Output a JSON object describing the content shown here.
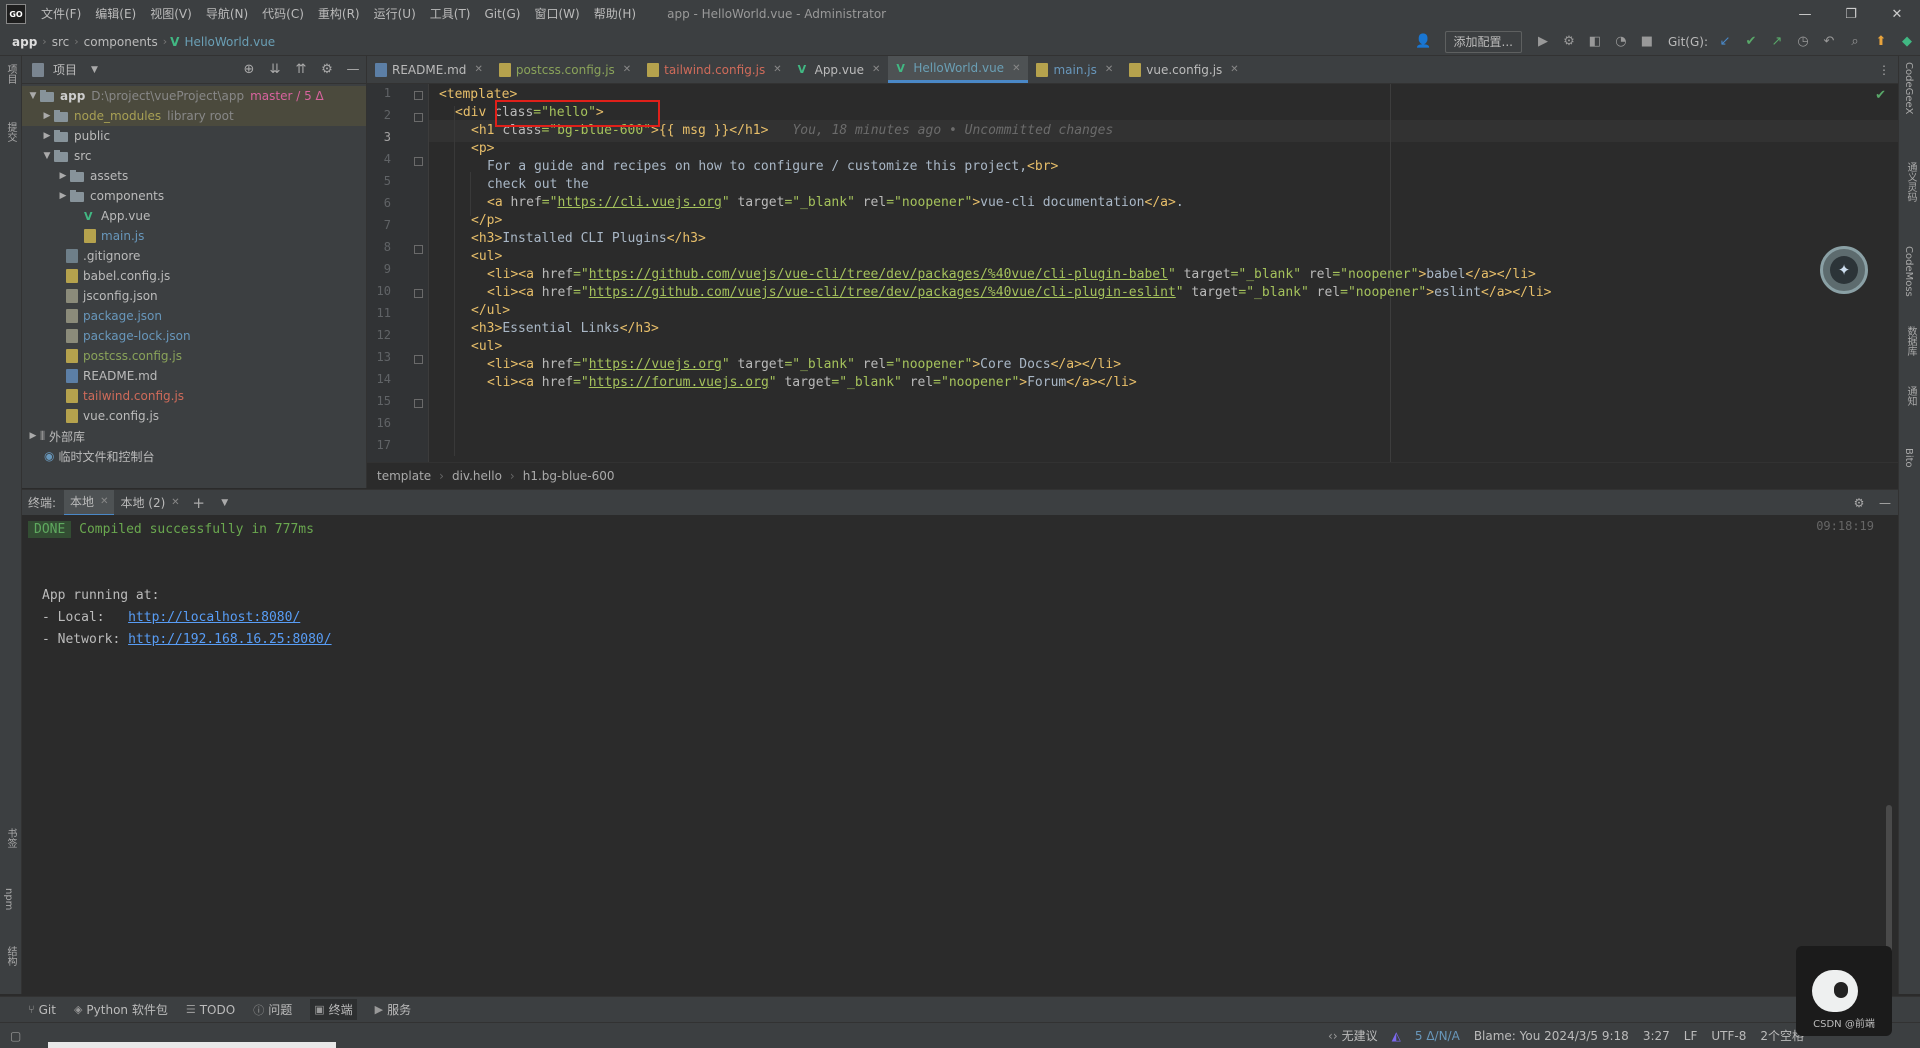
{
  "titlebar": {
    "logo": "GO",
    "menus": [
      "文件(F)",
      "编辑(E)",
      "视图(V)",
      "导航(N)",
      "代码(C)",
      "重构(R)",
      "运行(U)",
      "工具(T)",
      "Git(G)",
      "窗口(W)",
      "帮助(H)"
    ],
    "title": "app - HelloWorld.vue - Administrator"
  },
  "navbar": {
    "crumbs": [
      "app",
      "src",
      "components",
      "HelloWorld.vue"
    ],
    "add_config": "添加配置...",
    "git_label": "Git(G):"
  },
  "left_strip": {
    "labels": [
      "项目",
      "提交",
      "书签",
      "npm",
      "结构"
    ]
  },
  "right_strip": {
    "labels": [
      "CodeGeeX",
      "通义灵码",
      "CodeMoss",
      "数据库",
      "通知",
      "Bito"
    ]
  },
  "project_panel": {
    "title": "项目",
    "tree": [
      {
        "name": "app",
        "extra": "D:\\project\\vueProject\\app",
        "branch": "master / 5 Δ"
      },
      {
        "name": "node_modules",
        "extra": "library root"
      },
      {
        "name": "public"
      },
      {
        "name": "src"
      },
      {
        "name": "assets"
      },
      {
        "name": "components"
      },
      {
        "name": "App.vue"
      },
      {
        "name": "main.js"
      },
      {
        "name": ".gitignore"
      },
      {
        "name": "babel.config.js"
      },
      {
        "name": "jsconfig.json"
      },
      {
        "name": "package.json"
      },
      {
        "name": "package-lock.json"
      },
      {
        "name": "postcss.config.js"
      },
      {
        "name": "README.md"
      },
      {
        "name": "tailwind.config.js"
      },
      {
        "name": "vue.config.js"
      },
      {
        "name": "外部库"
      },
      {
        "name": "临时文件和控制台"
      }
    ]
  },
  "editor_tabs": [
    "README.md",
    "postcss.config.js",
    "tailwind.config.js",
    "App.vue",
    "HelloWorld.vue",
    "main.js",
    "vue.config.js"
  ],
  "editor": {
    "line_numbers": [
      "1",
      "2",
      "3",
      "4",
      "5",
      "6",
      "7",
      "8",
      "9",
      "10",
      "11",
      "12",
      "13",
      "14",
      "15",
      "16",
      "17"
    ],
    "l1": "<template>",
    "l2a": "<div ",
    "l2b": "class",
    "l2c": "=",
    "l2d": "\"hello\"",
    "l2e": ">",
    "l3a": "<h1 ",
    "l3b": "class",
    "l3c": "=",
    "l3d": "\"bg-blue-600\"",
    "l3e": ">{{ msg }}</h1>",
    "l3_blame": "You, 18 minutes ago • Uncommitted changes",
    "l4": "<p>",
    "l5a": "For a guide and recipes on how to configure / customize this project,",
    "l5b": "<br>",
    "l6": "check out the",
    "l7a": "<a ",
    "l7b": "href",
    "l7c": "=\"",
    "l7d": "https://cli.vuejs.org",
    "l7e": "\" ",
    "l7f": "target",
    "l7g": "=\"_blank\" ",
    "l7h": "rel",
    "l7i": "=\"noopener\"",
    "l7j": ">",
    "l7k": "vue-cli documentation",
    "l7l": "</a>",
    "l7m": ".",
    "l8": "</p>",
    "l9a": "<h3>",
    "l9b": "Installed CLI Plugins",
    "l9c": "</h3>",
    "l10": "<ul>",
    "l11a": "<li><a ",
    "l11b": "href",
    "l11c": "=\"",
    "l11d": "https://github.com/vuejs/vue-cli/tree/dev/packages/%40vue/cli-plugin-babel",
    "l11e": "\" ",
    "l11f": "target",
    "l11g": "=\"_blank\" ",
    "l11h": "rel",
    "l11i": "=\"noopener\"",
    "l11j": ">",
    "l11k": "babel",
    "l11l": "</a></li>",
    "l12a": "<li><a ",
    "l12b": "href",
    "l12c": "=\"",
    "l12d": "https://github.com/vuejs/vue-cli/tree/dev/packages/%40vue/cli-plugin-eslint",
    "l12e": "\" ",
    "l12f": "target",
    "l12g": "=\"_blank\" ",
    "l12h": "rel",
    "l12i": "=\"noopener\"",
    "l12j": ">",
    "l12k": "eslint",
    "l12l": "</a></li>",
    "l13": "</ul>",
    "l14a": "<h3>",
    "l14b": "Essential Links",
    "l14c": "</h3>",
    "l15": "<ul>",
    "l16a": "<li><a ",
    "l16b": "href",
    "l16c": "=\"",
    "l16d": "https://vuejs.org",
    "l16e": "\" ",
    "l16f": "target",
    "l16g": "=\"_blank\" ",
    "l16h": "rel",
    "l16i": "=\"noopener\"",
    "l16j": ">",
    "l16k": "Core Docs",
    "l16l": "</a></li>",
    "l17a": "<li><a ",
    "l17b": "href",
    "l17c": "=\"",
    "l17d": "https://forum.vuejs.org",
    "l17e": "\" ",
    "l17f": "target",
    "l17g": "=\"_blank\" ",
    "l17h": "rel",
    "l17i": "=\"noopener\"",
    "l17j": ">",
    "l17k": "Forum",
    "l17l": "</a></li>"
  },
  "editor_crumbs": [
    "template",
    "div.hello",
    "h1.bg-blue-600"
  ],
  "terminal": {
    "title": "终端:",
    "tabs": [
      "本地",
      "本地 (2)"
    ],
    "done": "DONE",
    "compiled": "Compiled successfully in 777ms",
    "timestamp": "09:18:19",
    "running": "App running at:",
    "local_label": "- Local:   ",
    "local_url": "http://localhost:8080/",
    "network_label": "- Network: ",
    "network_url": "http://192.168.16.25:8080/"
  },
  "tool_tabs": [
    "Git",
    "Python 软件包",
    "TODO",
    "问题",
    "终端",
    "服务"
  ],
  "status": {
    "suggest": "无建议",
    "na": "5 Δ/N/A",
    "blame": "Blame: You 2024/3/5 9:18",
    "pos": "3:27",
    "lf": "LF",
    "enc": "UTF-8",
    "indent": "2个空格"
  },
  "corner_mascot": {
    "label": "CSDN @前端"
  },
  "colors": {
    "accent": "#4a88c7",
    "highlight_box": "#e0201a",
    "done_green": "#6aa84f"
  }
}
